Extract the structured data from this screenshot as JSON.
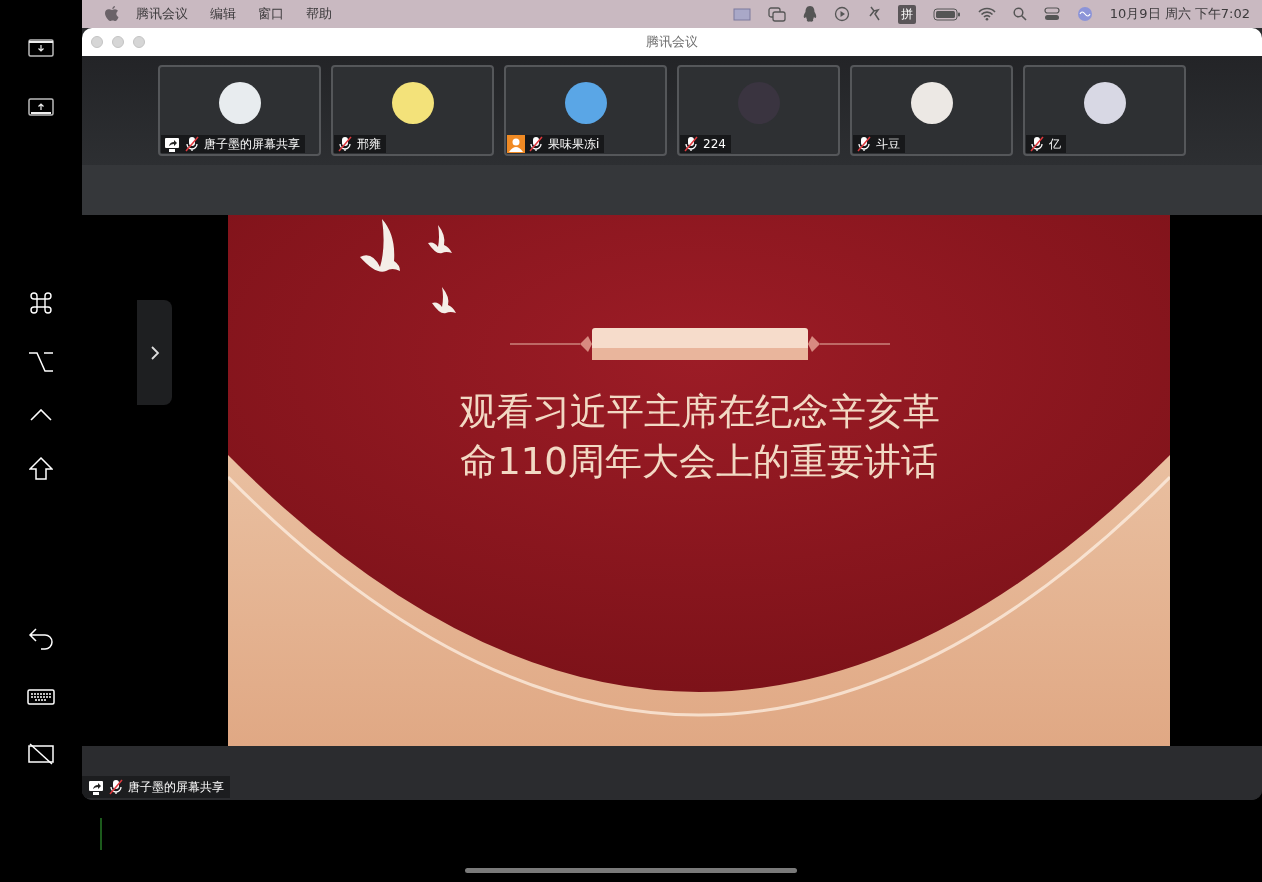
{
  "menu_bar": {
    "app_name": "腾讯会议",
    "menus": [
      "编辑",
      "窗口",
      "帮助"
    ],
    "input_method": "拼",
    "clock": "10月9日 周六 下午7:02"
  },
  "window": {
    "title": "腾讯会议"
  },
  "participants": [
    {
      "name": "唐子墨的屏幕共享",
      "screen_sharing": true,
      "no_video": false,
      "muted": true,
      "color": "#e8ecef"
    },
    {
      "name": "邢雍",
      "screen_sharing": false,
      "no_video": false,
      "muted": true,
      "color": "#f3e27a"
    },
    {
      "name": "果味果冻i",
      "screen_sharing": false,
      "no_video": true,
      "muted": true,
      "color": "#5aa6e6"
    },
    {
      "name": "224",
      "screen_sharing": false,
      "no_video": false,
      "muted": true,
      "color": "#3a3440"
    },
    {
      "name": "斗豆",
      "screen_sharing": false,
      "no_video": false,
      "muted": true,
      "color": "#ece8e4"
    },
    {
      "name": "亿",
      "screen_sharing": false,
      "no_video": false,
      "muted": true,
      "color": "#d8d8e4"
    }
  ],
  "slide": {
    "title_lines": [
      "观看习近平主席在纪念辛亥革",
      "命110周年大会上的重要讲话"
    ]
  },
  "presenter_label": {
    "name": "唐子墨的屏幕共享",
    "screen_sharing": true,
    "muted": true
  }
}
